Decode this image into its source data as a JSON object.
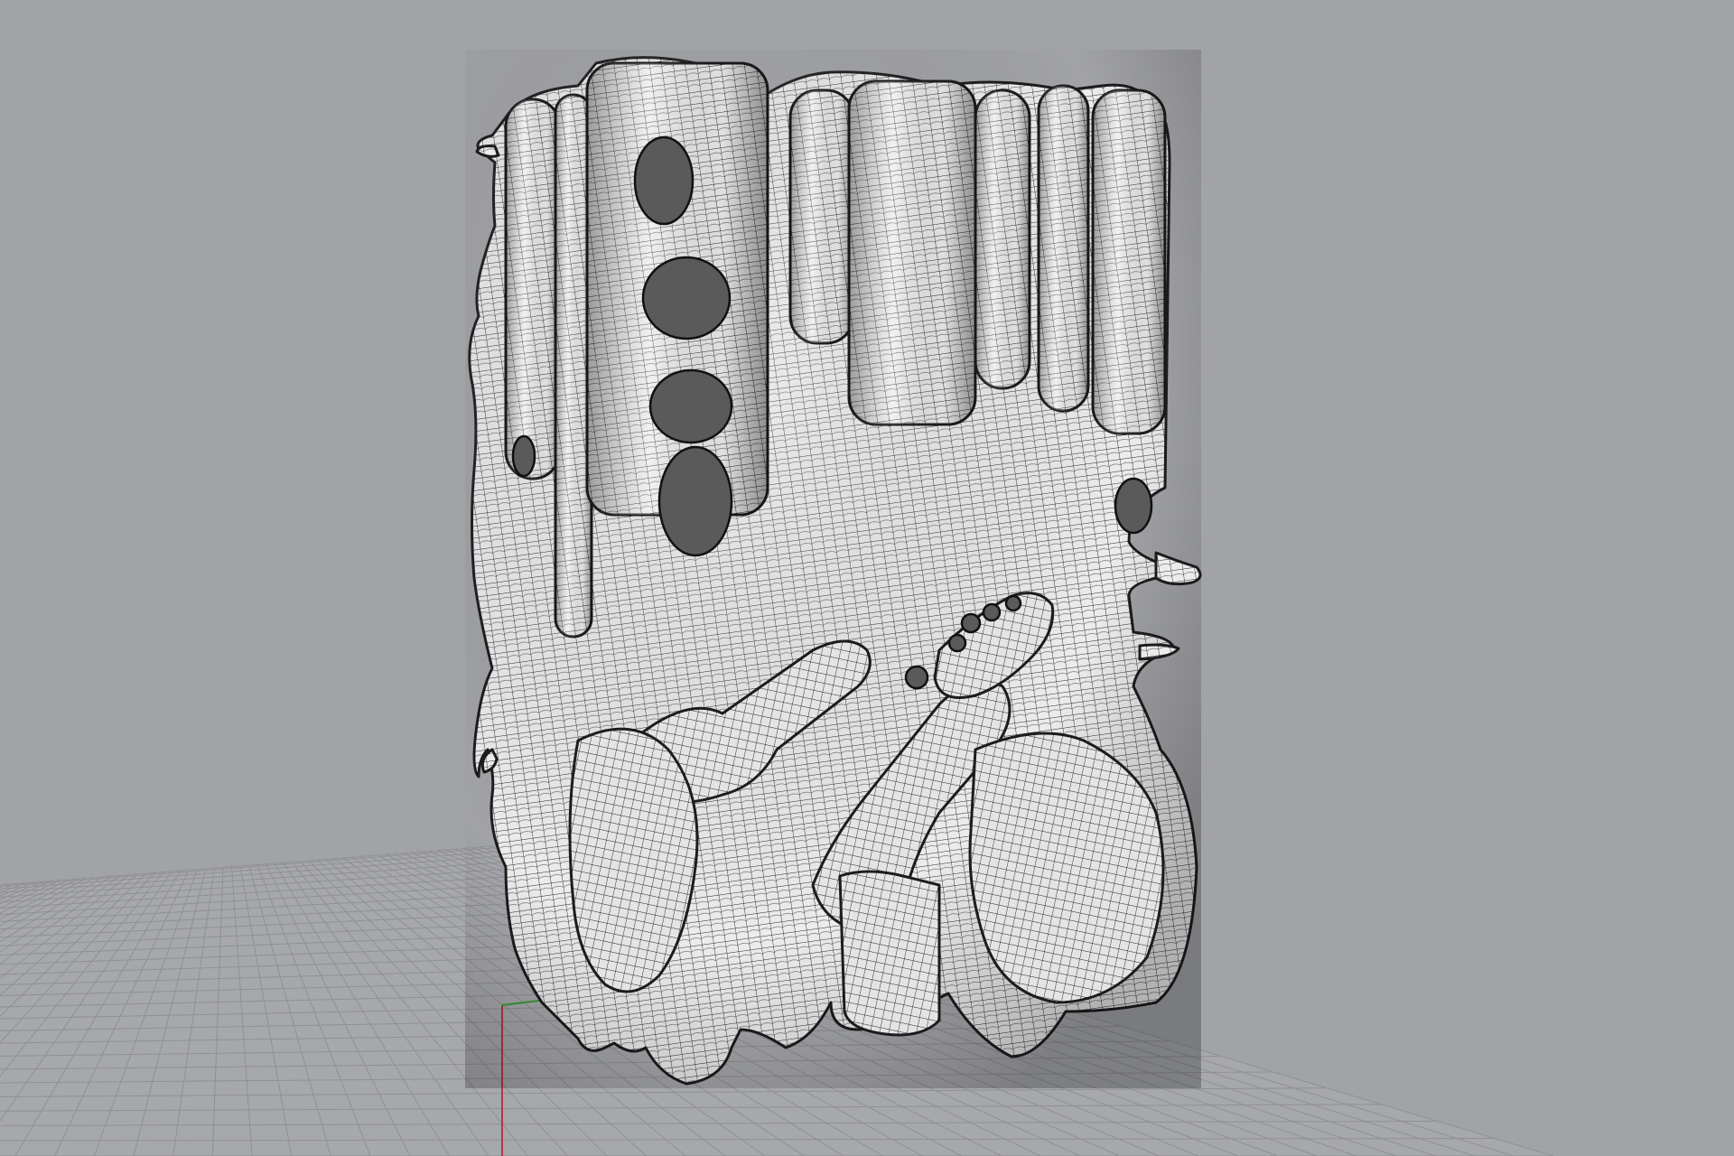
{
  "viewport": {
    "view": "perspective",
    "display_mode": "shaded-with-mesh-wireframe",
    "background_color": "#a2a3a7",
    "grid": {
      "visible": true,
      "line_color": "#8f9095",
      "plane_color": "#a6a7ab",
      "x_axis_color": "#b23a3a",
      "y_axis_color": "#3a9a3a"
    },
    "model": {
      "description_icon": "quad-mesh-icon",
      "surface_color": "#eeeeee",
      "wire_color": "#2a2a2a"
    }
  }
}
